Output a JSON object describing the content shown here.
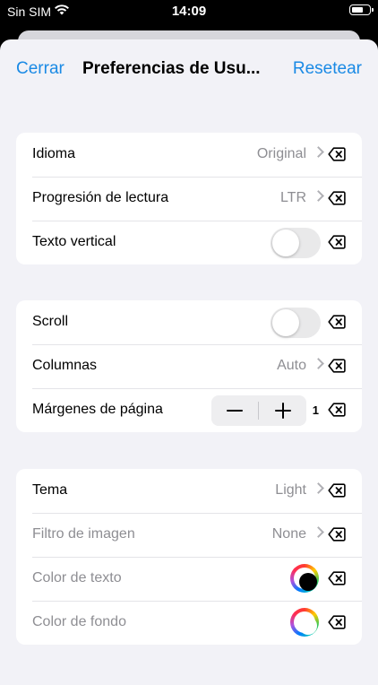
{
  "status_bar": {
    "carrier": "Sin SIM",
    "time": "14:09",
    "icons": [
      "wifi-icon",
      "battery-icon"
    ]
  },
  "nav": {
    "left_label": "Cerrar",
    "title": "Preferencias de Usu...",
    "right_label": "Resetear",
    "accent": "#1a8ae5"
  },
  "groups": [
    {
      "rows": [
        {
          "label": "Idioma",
          "value": "Original"
        },
        {
          "label": "Progresión de lectura",
          "value": "LTR"
        },
        {
          "label": "Texto vertical",
          "toggle_on": false
        }
      ]
    },
    {
      "rows": [
        {
          "label": "Scroll",
          "toggle_on": false
        },
        {
          "label": "Columnas",
          "value": "Auto"
        },
        {
          "label": "Márgenes de página",
          "stepper_value": "1"
        }
      ]
    },
    {
      "rows": [
        {
          "label": "Tema",
          "value": "Light"
        },
        {
          "label": "Filtro de imagen",
          "value": "None",
          "disabled": true
        },
        {
          "label": "Color de texto",
          "color": "#000000",
          "disabled": true
        },
        {
          "label": "Color de fondo",
          "color": "#ffffff",
          "disabled": true
        }
      ]
    }
  ]
}
